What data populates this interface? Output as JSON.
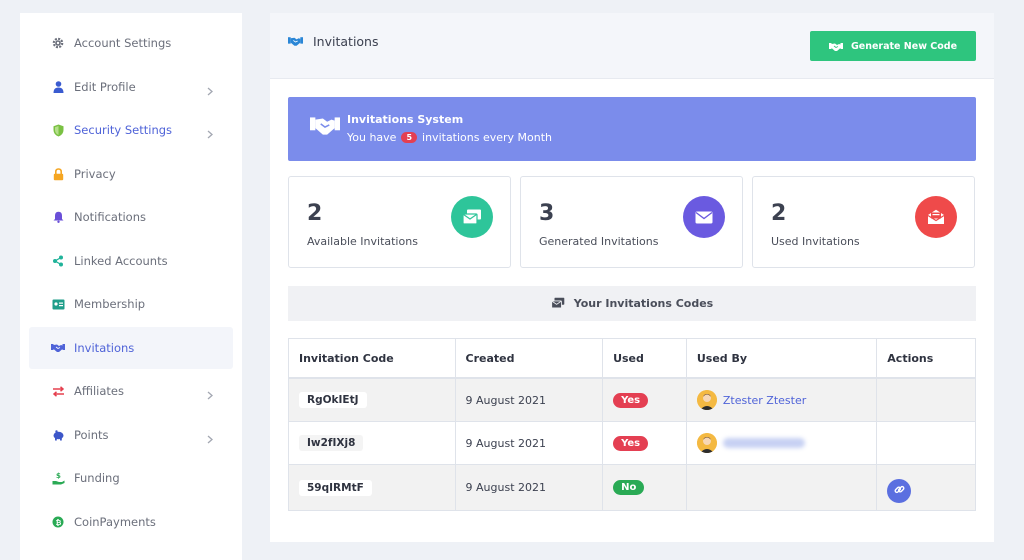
{
  "sidebar": {
    "items": [
      {
        "label": "Account Settings"
      },
      {
        "label": "Edit Profile"
      },
      {
        "label": "Security Settings"
      },
      {
        "label": "Privacy"
      },
      {
        "label": "Notifications"
      },
      {
        "label": "Linked Accounts"
      },
      {
        "label": "Membership"
      },
      {
        "label": "Invitations"
      },
      {
        "label": "Affiliates"
      },
      {
        "label": "Points"
      },
      {
        "label": "Funding"
      },
      {
        "label": "CoinPayments"
      }
    ]
  },
  "header": {
    "title": "Invitations",
    "generate_button": "Generate New Code"
  },
  "banner": {
    "title": "Invitations System",
    "prefix": "You have",
    "count": "5",
    "suffix": "invitations every Month"
  },
  "stats": [
    {
      "value": "2",
      "label": "Available Invitations",
      "color": "#2ec59a"
    },
    {
      "value": "3",
      "label": "Generated Invitations",
      "color": "#6a5ae0"
    },
    {
      "value": "2",
      "label": "Used Invitations",
      "color": "#ef4a4a"
    }
  ],
  "codes_section": {
    "title": "Your Invitations Codes"
  },
  "table": {
    "headers": [
      "Invitation Code",
      "Created",
      "Used",
      "Used By",
      "Actions"
    ],
    "rows": [
      {
        "code": "RgOkIEtJ",
        "created": "9 August 2021",
        "used": "Yes",
        "used_by": "Ztester Ztester"
      },
      {
        "code": "Iw2fIXj8",
        "created": "9 August 2021",
        "used": "Yes",
        "used_by": ""
      },
      {
        "code": "59qIRMtF",
        "created": "9 August 2021",
        "used": "No",
        "used_by": ""
      }
    ]
  },
  "colors": {
    "accent": "#4f63d8",
    "banner": "#7b8ceb",
    "green": "#2ec57e",
    "red": "#e43f52"
  }
}
